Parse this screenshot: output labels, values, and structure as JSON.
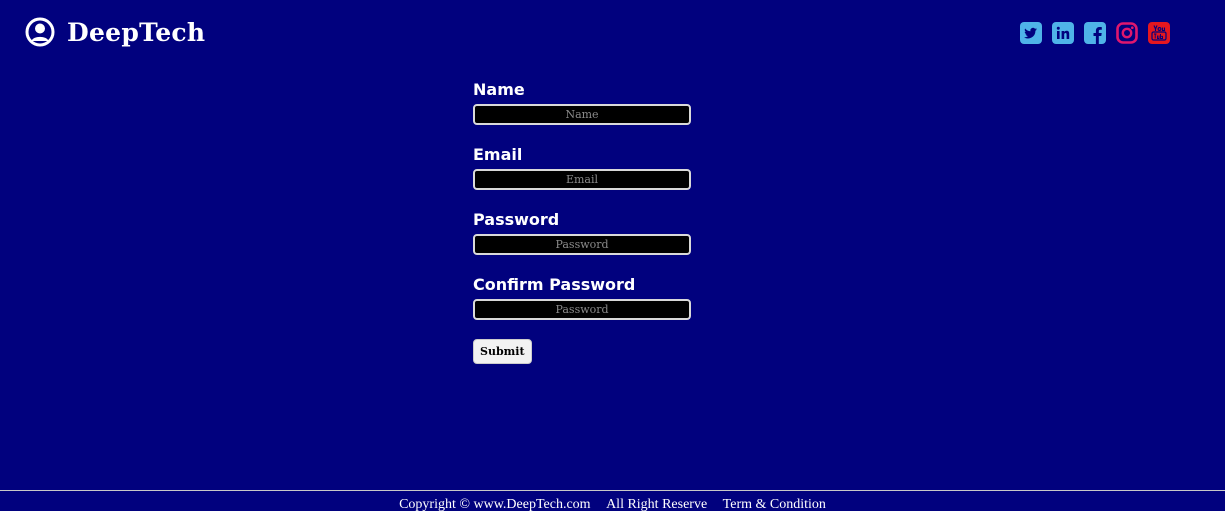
{
  "header": {
    "brand": "DeepTech",
    "social": [
      {
        "icon": "twitter-icon",
        "color": "#4fb3e8"
      },
      {
        "icon": "linkedin-icon",
        "color": "#4fb3e8"
      },
      {
        "icon": "facebook-icon",
        "color": "#4fb3e8"
      },
      {
        "icon": "instagram-icon",
        "color": "#e0176e"
      },
      {
        "icon": "youtube-icon",
        "color": "#e5171f"
      }
    ]
  },
  "form": {
    "name": {
      "label": "Name",
      "placeholder": "Name"
    },
    "email": {
      "label": "Email",
      "placeholder": "Email"
    },
    "password": {
      "label": "Password",
      "placeholder": "Password"
    },
    "confirm_password": {
      "label": "Confirm Password",
      "placeholder": "Password"
    },
    "submit_label": "Submit"
  },
  "footer": {
    "copyright": "Copyright © www.DeepTech.com",
    "rights": "All Right Reserve",
    "terms": "Term & Condition"
  },
  "colors": {
    "background": "#01017e",
    "input_background": "#000000"
  }
}
